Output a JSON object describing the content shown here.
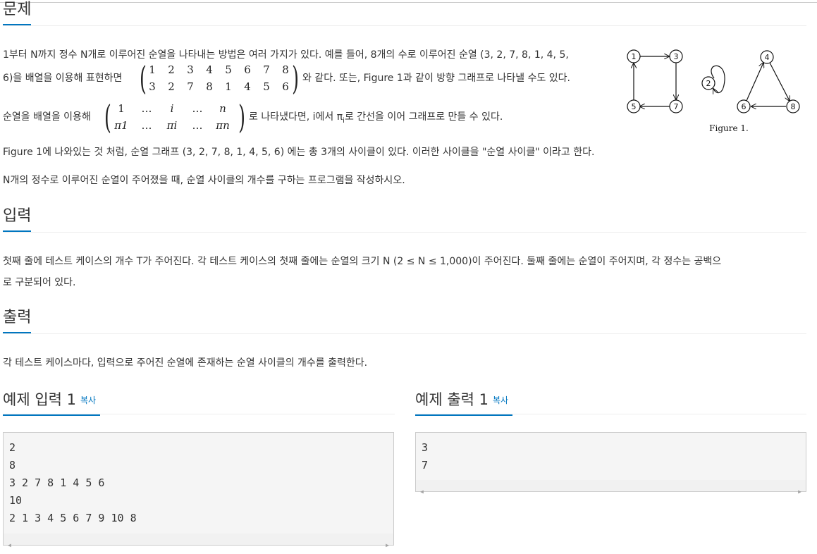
{
  "sections": {
    "problem": "문제",
    "input": "입력",
    "output": "출력",
    "sample_input": "예제 입력 1",
    "sample_output": "예제 출력 1",
    "copy_label": "복사"
  },
  "problem": {
    "line1": "1부터 N까지 정수 N개로 이루어진 순열을 나타내는 방법은 여러 가지가 있다. 예를 들어, 8개의 수로 이루어진 순열 (3, 2, 7, 8, 1, 4, 5,",
    "line2_pre": "6)을 배열을 이용해 표현하면",
    "line2_post": "와 같다. 또는, Figure 1과 같이 방향 그래프로 나타낼 수도 있다.",
    "line3_pre": "순열을 배열을 이용해",
    "line3_post_a": "로 나타냈다면, i에서 π",
    "line3_sub": "i",
    "line3_post_b": "로 간선을 이어 그래프로 만들 수 있다.",
    "line4": "Figure 1에 나와있는 것 처럼, 순열 그래프 (3, 2, 7, 8, 1, 4, 5, 6) 에는 총 3개의 사이클이 있다. 이러한 사이클을 \"순열 사이클\" 이라고 한다.",
    "line5": "N개의 정수로 이루어진 순열이 주어졌을 때, 순열 사이클의 개수를 구하는 프로그램을 작성하시오."
  },
  "matrix1": {
    "top": [
      "1",
      "2",
      "3",
      "4",
      "5",
      "6",
      "7",
      "8"
    ],
    "bottom": [
      "3",
      "2",
      "7",
      "8",
      "1",
      "4",
      "5",
      "6"
    ]
  },
  "matrix2": {
    "top": [
      "1",
      "…",
      "i",
      "…",
      "n"
    ],
    "bottom": [
      "π1",
      "…",
      "πi",
      "…",
      "πn"
    ]
  },
  "figure": {
    "caption": "Figure 1.",
    "nodes": [
      "1",
      "3",
      "5",
      "7",
      "2",
      "4",
      "6",
      "8"
    ]
  },
  "input_text": {
    "line1": "첫째 줄에 테스트 케이스의 개수 T가 주어진다. 각 테스트 케이스의 첫째 줄에는 순열의 크기 N (2 ≤ N ≤ 1,000)이 주어진다. 둘째 줄에는 순열이 주어지며, 각 정수는 공백으",
    "line2": "로 구분되어 있다."
  },
  "output_text": {
    "line1": "각 테스트 케이스마다, 입력으로 주어진 순열에 존재하는 순열 사이클의 개수를 출력한다."
  },
  "sample_input_block": "2\n8\n3 2 7 8 1 4 5 6\n10\n2 1 3 4 5 6 7 9 10 8",
  "sample_output_block": "3\n7"
}
